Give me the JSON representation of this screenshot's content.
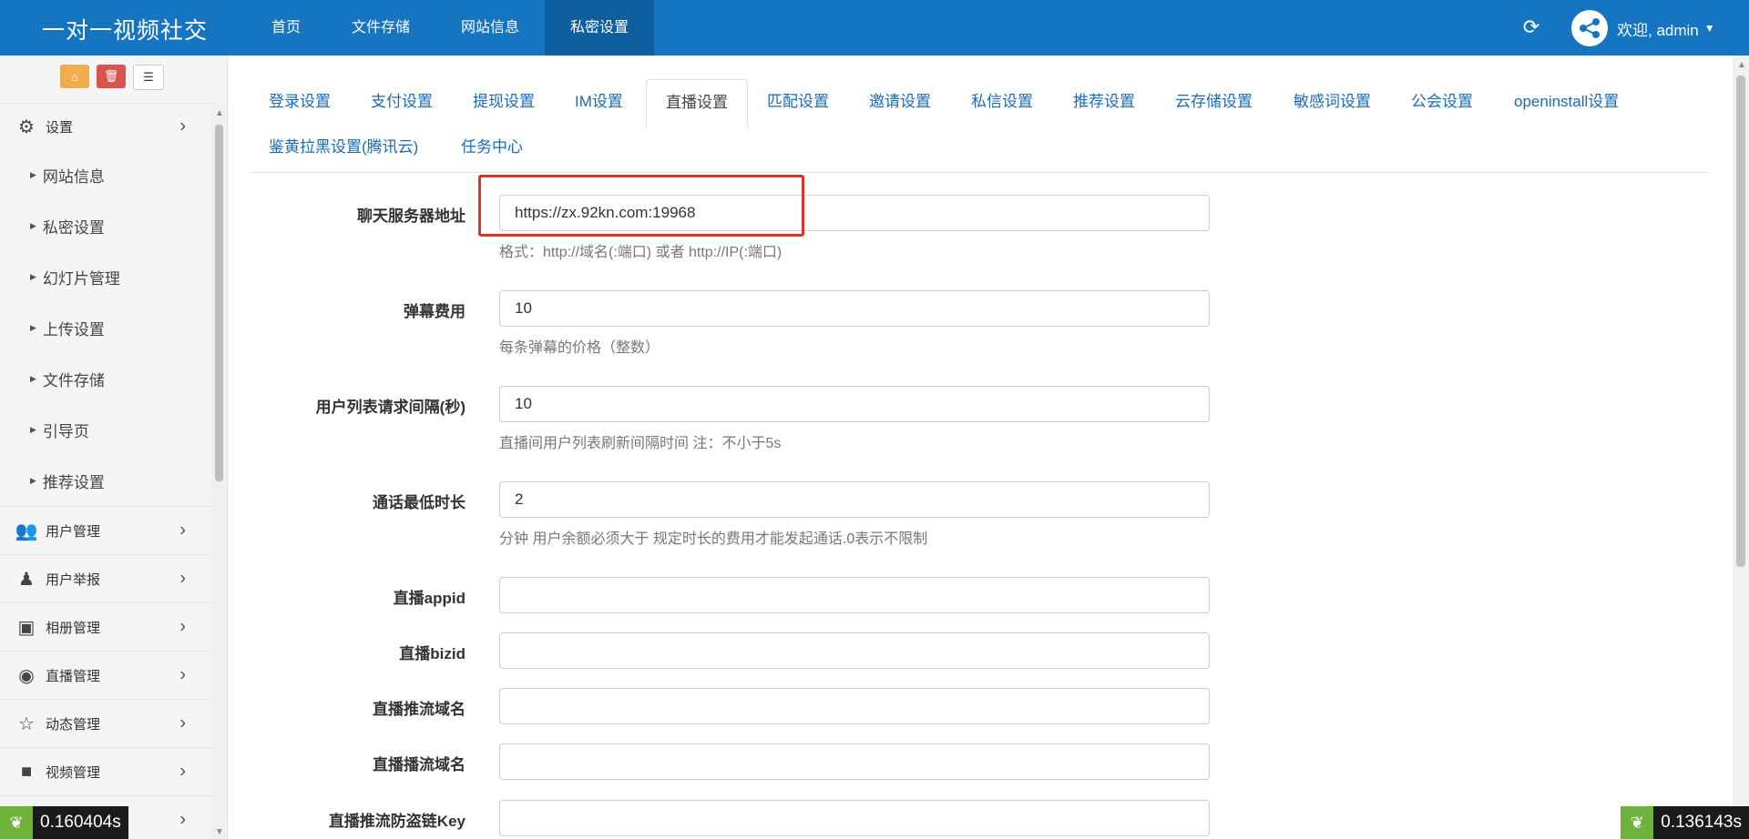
{
  "app": {
    "title": "一对一视频社交"
  },
  "top_nav": [
    {
      "label": "首页"
    },
    {
      "label": "文件存储"
    },
    {
      "label": "网站信息"
    },
    {
      "label": "私密设置"
    }
  ],
  "user": {
    "greeting": "欢迎, admin"
  },
  "sidebar": {
    "settings_label": "设置",
    "sub_items": [
      {
        "label": "网站信息"
      },
      {
        "label": "私密设置"
      },
      {
        "label": "幻灯片管理"
      },
      {
        "label": "上传设置"
      },
      {
        "label": "文件存储"
      },
      {
        "label": "引导页"
      },
      {
        "label": "推荐设置"
      }
    ],
    "groups": [
      {
        "label": "用户管理",
        "icon": "users-icon"
      },
      {
        "label": "用户举报",
        "icon": "user-report-icon"
      },
      {
        "label": "相册管理",
        "icon": "image-icon"
      },
      {
        "label": "直播管理",
        "icon": "eye-icon"
      },
      {
        "label": "动态管理",
        "icon": "star-icon"
      },
      {
        "label": "视频管理",
        "icon": "video-icon"
      }
    ]
  },
  "tabs": [
    {
      "label": "登录设置"
    },
    {
      "label": "支付设置"
    },
    {
      "label": "提现设置"
    },
    {
      "label": "IM设置"
    },
    {
      "label": "直播设置"
    },
    {
      "label": "匹配设置"
    },
    {
      "label": "邀请设置"
    },
    {
      "label": "私信设置"
    },
    {
      "label": "推荐设置"
    },
    {
      "label": "云存储设置"
    },
    {
      "label": "敏感词设置"
    },
    {
      "label": "公会设置"
    },
    {
      "label": "openinstall设置"
    },
    {
      "label": "鉴黄拉黑设置(腾讯云)"
    },
    {
      "label": "任务中心"
    }
  ],
  "form": {
    "chat_server": {
      "label": "聊天服务器地址",
      "value": "https://zx.92kn.com:19968",
      "help": "格式：http://域名(:端口) 或者 http://IP(:端口)"
    },
    "barrage_fee": {
      "label": "弹幕费用",
      "value": "10",
      "help": "每条弹幕的价格（整数）"
    },
    "user_list_interval": {
      "label": "用户列表请求间隔(秒)",
      "value": "10",
      "help": "直播间用户列表刷新间隔时间 注：不小于5s"
    },
    "min_call_duration": {
      "label": "通话最低时长",
      "value": "2",
      "help": "分钟 用户余额必须大于 规定时长的费用才能发起通话.0表示不限制"
    },
    "live_appid": {
      "label": "直播appid",
      "value": ""
    },
    "live_bizid": {
      "label": "直播bizid",
      "value": ""
    },
    "push_domain": {
      "label": "直播推流域名",
      "value": ""
    },
    "play_domain": {
      "label": "直播播流域名",
      "value": ""
    },
    "push_key": {
      "label": "直播推流防盗链Key",
      "value": ""
    }
  },
  "timers": {
    "left": "0.160404s",
    "right": "0.136143s"
  },
  "colors": {
    "topbar": "#1575c1",
    "link": "#1a6bb7",
    "highlight": "#e0322c"
  }
}
